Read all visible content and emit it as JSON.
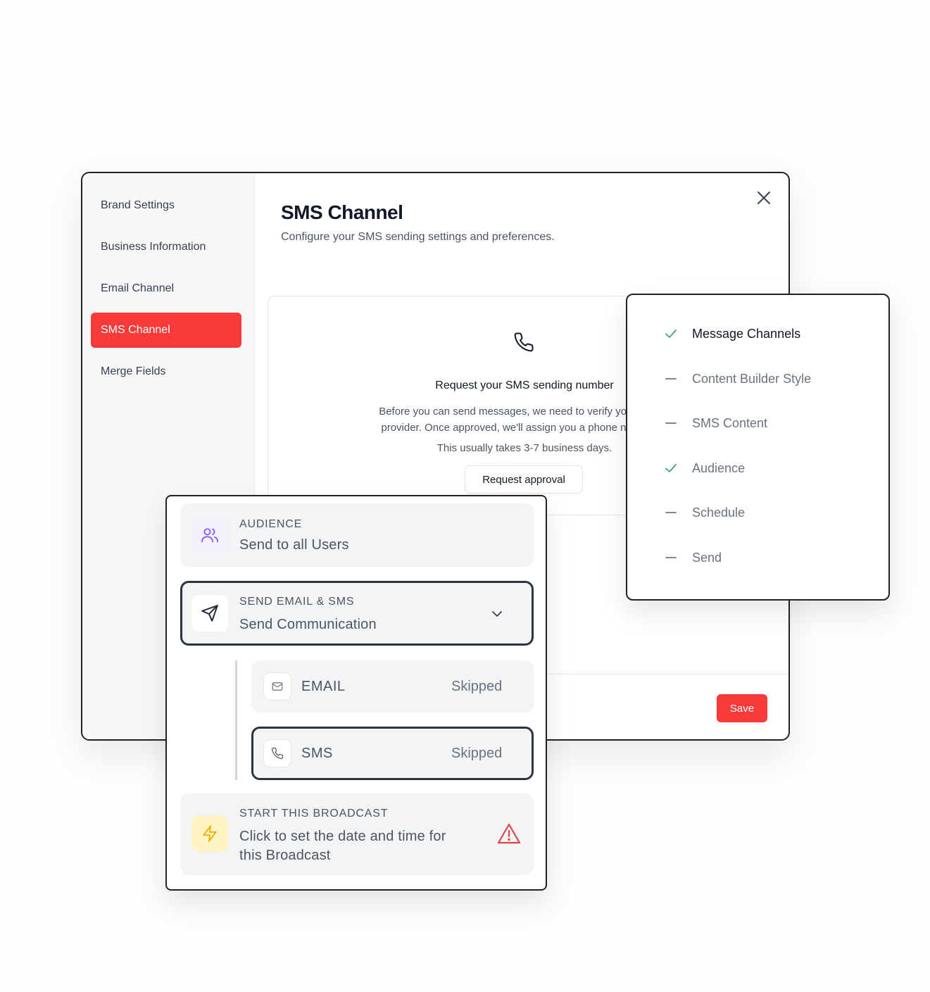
{
  "sidebar": {
    "items": [
      {
        "label": "Brand Settings",
        "active": false
      },
      {
        "label": "Business Information",
        "active": false
      },
      {
        "label": "Email Channel",
        "active": false
      },
      {
        "label": "SMS Channel",
        "active": true
      },
      {
        "label": "Merge Fields",
        "active": false
      }
    ]
  },
  "header": {
    "title": "SMS Channel",
    "subtitle": "Configure your SMS sending settings and preferences.",
    "close_icon": "close-icon"
  },
  "request": {
    "icon": "phone-icon",
    "title": "Request your SMS sending number",
    "body_line1": "Before you can send messages, we need to verify your busine",
    "body_line2": "provider. Once approved, we'll assign you a phone number to",
    "note": "This usually takes 3-7 business days.",
    "button_label": "Request approval"
  },
  "footer": {
    "save_label": "Save",
    "accent": "#f83a3a"
  },
  "steps": [
    {
      "label": "Message Channels",
      "status": "done",
      "current": true
    },
    {
      "label": "Content Builder Style",
      "status": "pending"
    },
    {
      "label": "SMS Content",
      "status": "pending"
    },
    {
      "label": "Audience",
      "status": "done"
    },
    {
      "label": "Schedule",
      "status": "pending"
    },
    {
      "label": "Send",
      "status": "pending"
    }
  ],
  "flow": {
    "audience": {
      "kicker": "AUDIENCE",
      "title": "Send to all Users",
      "icon": "users-icon"
    },
    "send": {
      "kicker": "SEND EMAIL & SMS",
      "title": "Send Communication",
      "icon": "send-icon",
      "chevron": "chevron-down-icon"
    },
    "channels": [
      {
        "label": "EMAIL",
        "status": "Skipped",
        "icon": "mail-icon"
      },
      {
        "label": "SMS",
        "status": "Skipped",
        "icon": "phone-icon"
      }
    ],
    "broadcast": {
      "kicker": "START THIS BROADCAST",
      "title_line1": "Click to set the date and time for",
      "title_line2": "this Broadcast",
      "icon": "lightning-icon",
      "warning_icon": "warning-icon"
    }
  }
}
